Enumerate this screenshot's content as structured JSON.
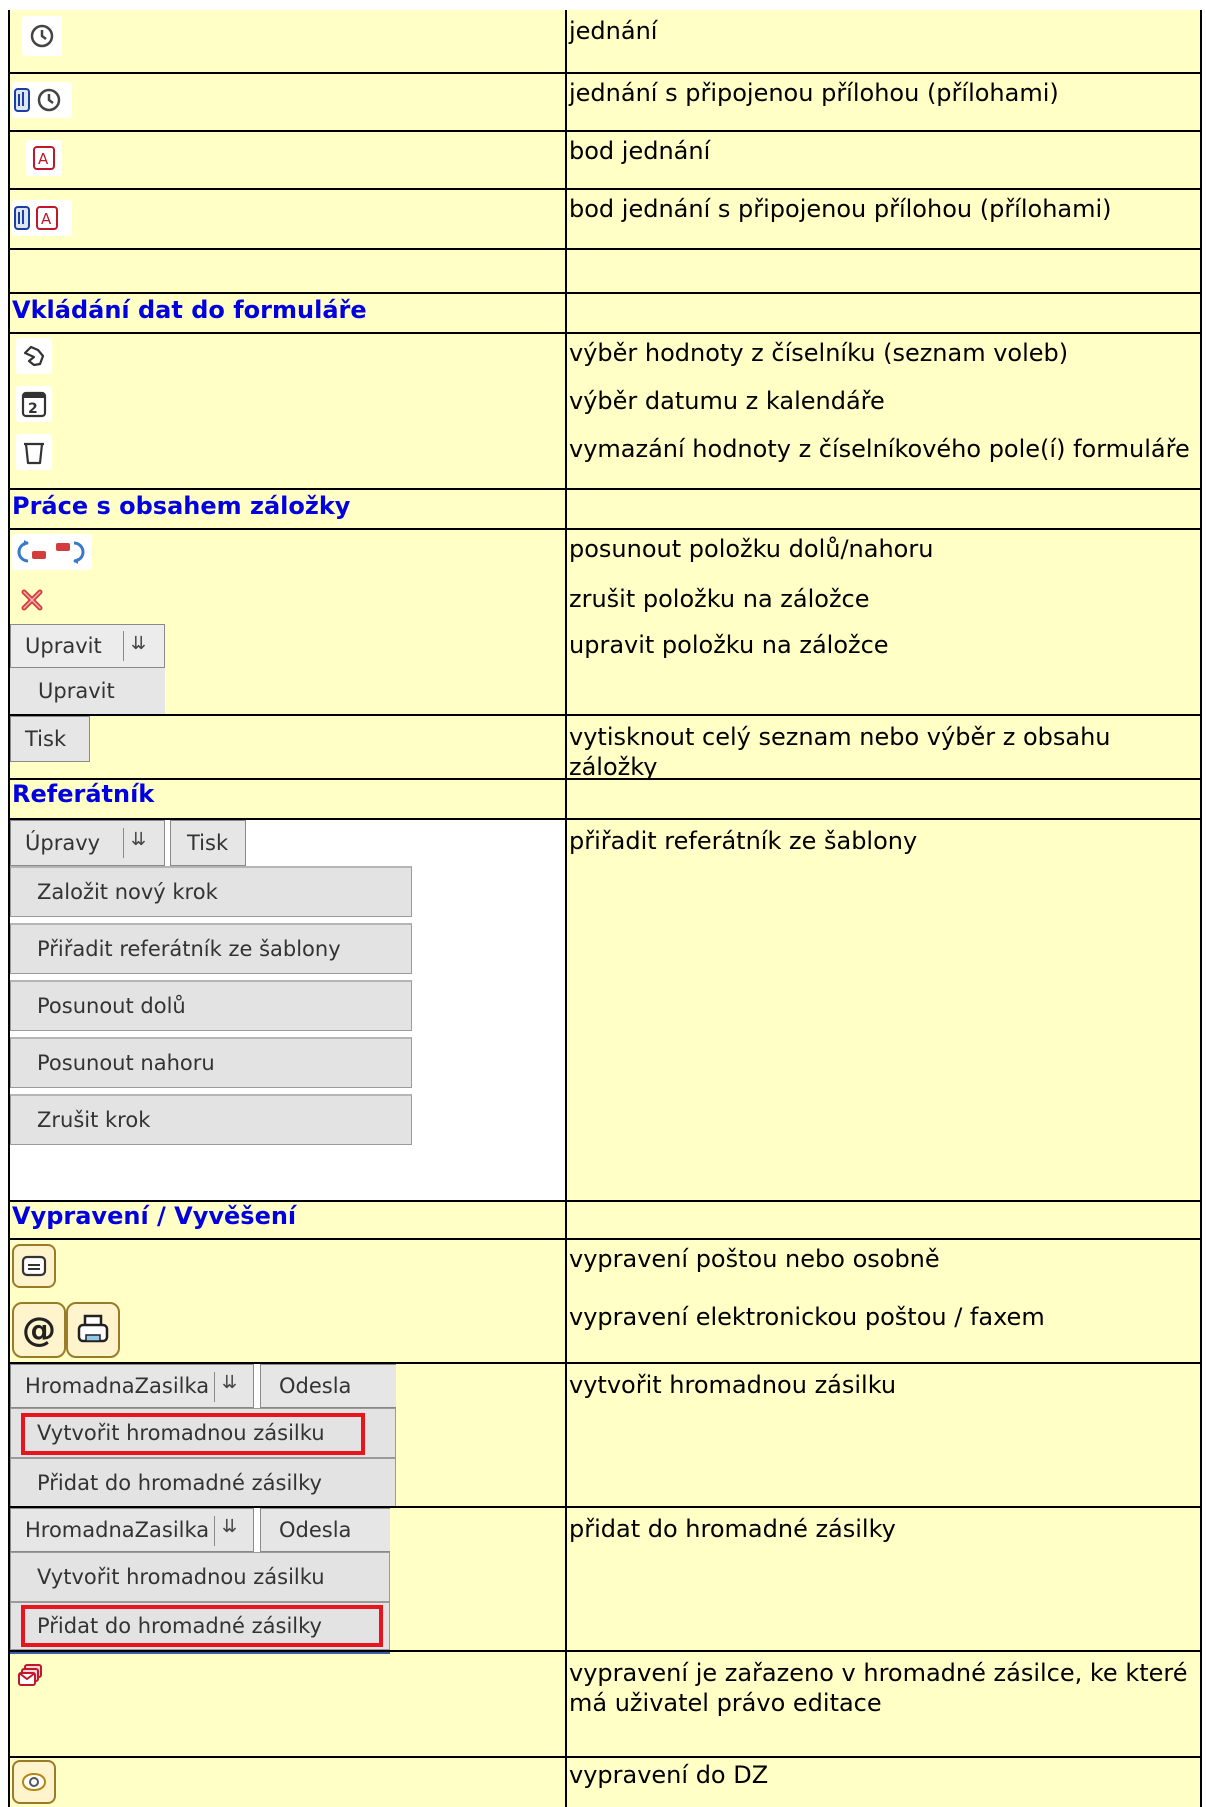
{
  "rows": [
    {
      "text": "jednání"
    },
    {
      "text": "jednání s připojenou přílohou (přílohami)"
    },
    {
      "text": "bod jednání"
    },
    {
      "text": "bod jednání s připojenou přílohou (přílohami)"
    },
    {
      "text": ""
    },
    {
      "text": "výběr hodnoty z číselníku (seznam voleb)"
    },
    {
      "text": "výběr datumu z kalendáře"
    },
    {
      "text": "vymazání hodnoty z číselníkového pole(í) formuláře"
    },
    {
      "text": "posunout položku dolů/nahoru"
    },
    {
      "text": "zrušit položku na záložce"
    },
    {
      "text": "upravit položku na záložce"
    },
    {
      "text": "vytisknout celý seznam nebo výběr z obsahu záložky"
    },
    {
      "text": "přiřadit referátník ze šablony"
    },
    {
      "text": "vypravení poštou nebo osobně"
    },
    {
      "text": "vypravení elektronickou poštou / faxem"
    },
    {
      "text": "vytvořit hromadnou zásilku"
    },
    {
      "text": "přidat do hromadné zásilky"
    },
    {
      "text": "vypravení je zařazeno v hromadné zásilce, ke které má uživatel právo editace"
    },
    {
      "text": "vypravení do DZ"
    }
  ],
  "sections": {
    "vkladani": "Vkládání dat do formuláře",
    "prace": "Práce s obsahem záložky",
    "referatnik": "Referátník",
    "vypraveni": "Vypravení / Vyvěšení"
  },
  "ui": {
    "upravit": "Upravit",
    "upravit_menu": "Upravit",
    "tisk": "Tisk",
    "upravy": "Úpravy",
    "tisk2": "Tisk",
    "ref_menu": [
      "Založit nový krok",
      "Přiřadit referátník ze šablony",
      "Posunout dolů",
      "Posunout nahoru",
      "Zrušit krok"
    ],
    "hz_label": "HromadnaZasilka",
    "odesla": "Odesla",
    "hz_create": "Vytvořit hromadnou zásilku",
    "hz_add": "Přidat do hromadné zásilky"
  },
  "icons": {
    "calendar_digit": "2",
    "at": "@"
  },
  "colors": {
    "background": "#ffffc6",
    "section": "#0000e0",
    "highlight": "#e8141e"
  }
}
